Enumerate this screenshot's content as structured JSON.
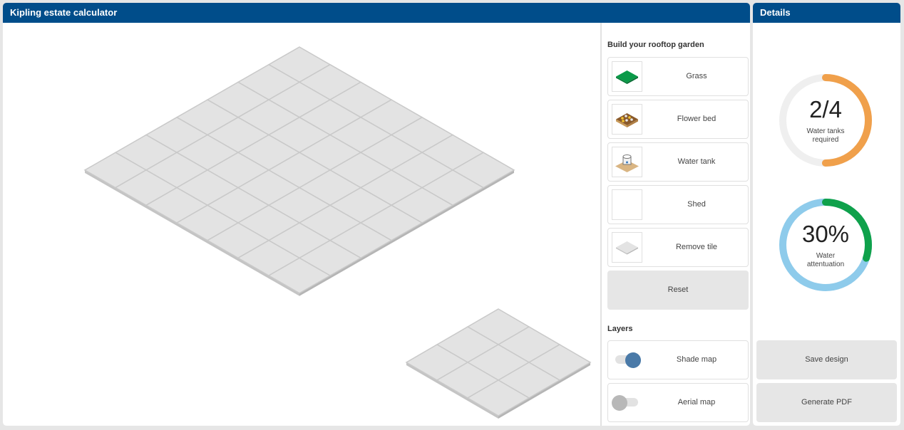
{
  "app": {
    "title": "Kipling estate calculator"
  },
  "details": {
    "title": "Details",
    "water_tanks": {
      "value": "2/4",
      "label_line1": "Water tanks",
      "label_line2": "required",
      "fraction": 0.5,
      "color": "#f0a04b",
      "track_color": "#efefef"
    },
    "attenuation": {
      "value": "30%",
      "label_line1": "Water",
      "label_line2": "attentuation",
      "fraction": 0.3,
      "color": "#0fa14b",
      "track_color": "#8ecbeb"
    },
    "save_label": "Save design",
    "pdf_label": "Generate PDF"
  },
  "tools": {
    "section_title": "Build your rooftop garden",
    "items": [
      {
        "label": "Grass",
        "icon": "grass-tile-icon"
      },
      {
        "label": "Flower bed",
        "icon": "flower-bed-icon"
      },
      {
        "label": "Water tank",
        "icon": "water-tank-icon"
      },
      {
        "label": "Shed",
        "icon": "shed-icon"
      },
      {
        "label": "Remove tile",
        "icon": "remove-tile-icon"
      }
    ],
    "reset_label": "Reset"
  },
  "layers": {
    "section_title": "Layers",
    "items": [
      {
        "label": "Shade map",
        "enabled": true,
        "knob_color": "#4a7aa8"
      },
      {
        "label": "Aerial map",
        "enabled": false,
        "knob_color": "#b8b8b8"
      }
    ]
  },
  "grids": [
    {
      "name": "main-roof",
      "rows": 7,
      "cols": 7
    },
    {
      "name": "small-roof",
      "rows": 3,
      "cols": 3
    }
  ],
  "colors": {
    "header": "#004d8a",
    "tile_fill": "#e3e3e3",
    "tile_line": "#c9c9c9",
    "tile_edge": "#b5b5b5"
  }
}
